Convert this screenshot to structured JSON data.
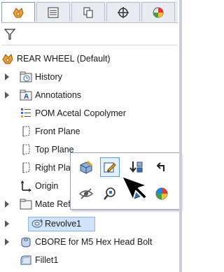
{
  "tabs": [
    {
      "icon": "feature-manager-icon",
      "active": true
    },
    {
      "icon": "property-manager-icon",
      "active": false
    },
    {
      "icon": "configuration-manager-icon",
      "active": false
    },
    {
      "icon": "dimxpert-icon",
      "active": false
    },
    {
      "icon": "display-manager-icon",
      "active": false
    }
  ],
  "filter_icon": "filter-icon",
  "tree": {
    "root": {
      "label": "REAR WHEEL  (Default)",
      "icon": "part-icon"
    },
    "items": [
      {
        "label": "History",
        "icon": "history-folder-icon",
        "expandable": true
      },
      {
        "label": "Annotations",
        "icon": "annotations-icon",
        "expandable": true
      },
      {
        "label": "POM Acetal Copolymer",
        "icon": "material-icon",
        "expandable": false
      },
      {
        "label": "Front Plane",
        "icon": "plane-icon",
        "expandable": false
      },
      {
        "label": "Top Plane",
        "icon": "plane-icon",
        "expandable": false
      },
      {
        "label": "Right Plane",
        "icon": "plane-icon",
        "expandable": false
      },
      {
        "label": "Origin",
        "icon": "origin-icon",
        "expandable": false
      },
      {
        "label": "Mate References",
        "icon": "mate-references-folder-icon",
        "expandable": true
      },
      {
        "label": "Revolve1",
        "icon": "revolve-feature-icon",
        "expandable": true,
        "selected": true
      },
      {
        "label": "CBORE for M5 Hex Head Bolt",
        "icon": "hole-wizard-icon",
        "expandable": true
      },
      {
        "label": "Fillet1",
        "icon": "fillet-icon",
        "expandable": false
      }
    ]
  },
  "context_toolbar": {
    "buttons": [
      {
        "icon": "edit-feature-icon"
      },
      {
        "icon": "edit-sketch-icon",
        "hot": true
      },
      {
        "icon": "rollback-icon"
      },
      {
        "icon": "parent-child-icon"
      },
      {
        "icon": "hide-icon"
      },
      {
        "icon": "zoom-to-selection-icon"
      },
      {
        "icon": "normal-to-icon"
      },
      {
        "icon": "appearance-icon"
      }
    ]
  },
  "colors": {
    "selection": "#cfe3fb",
    "selection_border": "#8cb6ea",
    "part_orange": "#f0a030"
  }
}
